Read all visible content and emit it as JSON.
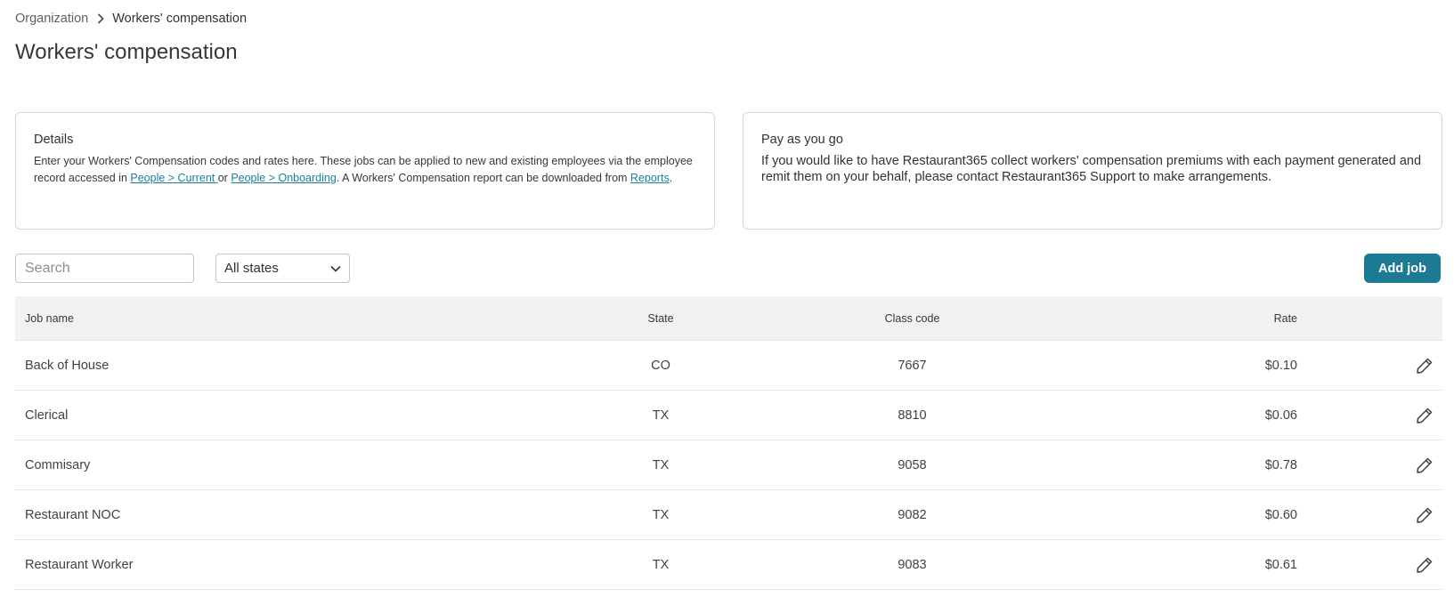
{
  "breadcrumb": {
    "parent": "Organization",
    "current": "Workers' compensation"
  },
  "page_title": "Workers' compensation",
  "details_card": {
    "title": "Details",
    "text_1": "Enter your Workers' Compensation codes and rates here. These jobs can be applied to new and existing employees via the employee record accessed in ",
    "link_current": "People > Current ",
    "text_2": "or ",
    "link_onboarding": "People > Onboarding",
    "text_3": ". A Workers' Compensation report can be downloaded from ",
    "link_reports": "Reports",
    "text_4": "."
  },
  "payg_card": {
    "title": "Pay as you go",
    "text": "If you would like to have Restaurant365 collect workers' compensation premiums with each payment generated and remit them on your behalf, please contact Restaurant365 Support to make arrangements."
  },
  "search": {
    "placeholder": "Search",
    "value": ""
  },
  "state_filter": {
    "selected": "All states"
  },
  "add_job_label": "Add job",
  "colors": {
    "accent": "#1d7a94",
    "link": "#1a7f9c",
    "header_bg": "#f2f2f2"
  },
  "table": {
    "headers": {
      "job_name": "Job name",
      "state": "State",
      "class_code": "Class code",
      "rate": "Rate"
    },
    "rows": [
      {
        "job_name": "Back of House",
        "state": "CO",
        "class_code": "7667",
        "rate": "$0.10"
      },
      {
        "job_name": "Clerical",
        "state": "TX",
        "class_code": "8810",
        "rate": "$0.06"
      },
      {
        "job_name": "Commisary",
        "state": "TX",
        "class_code": "9058",
        "rate": "$0.78"
      },
      {
        "job_name": "Restaurant NOC",
        "state": "TX",
        "class_code": "9082",
        "rate": "$0.60"
      },
      {
        "job_name": "Restaurant Worker",
        "state": "TX",
        "class_code": "9083",
        "rate": "$0.61"
      }
    ]
  }
}
